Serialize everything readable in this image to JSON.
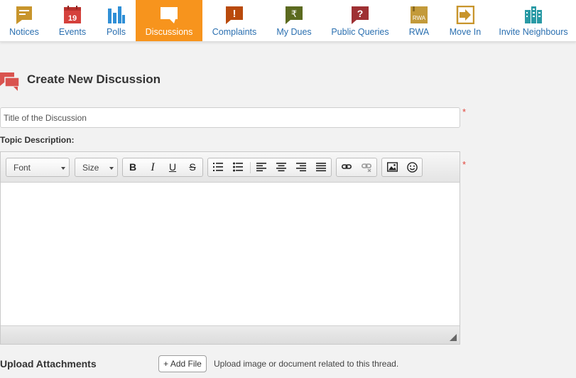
{
  "nav": {
    "items": [
      {
        "label": "Notices",
        "icon": "notice-icon",
        "color": "#c8952c"
      },
      {
        "label": "Events",
        "icon": "calendar-icon",
        "color": "#d5413c",
        "icon_text": "19"
      },
      {
        "label": "Polls",
        "icon": "bar-chart-icon",
        "color": "#2f8fd6"
      },
      {
        "label": "Discussions",
        "icon": "speech-bubble-icon",
        "color": "#ffffff",
        "active": true
      },
      {
        "label": "Complaints",
        "icon": "complaint-icon",
        "color": "#b94a0c",
        "icon_text": "!"
      },
      {
        "label": "My Dues",
        "icon": "rupee-icon",
        "color": "#5b6a1f",
        "icon_text": "₹"
      },
      {
        "label": "Public Queries",
        "icon": "question-icon",
        "color": "#9e3033",
        "icon_text": "?"
      },
      {
        "label": "RWA",
        "icon": "rwa-icon",
        "color": "#c39a3a",
        "icon_text": "RWA"
      },
      {
        "label": "Move In",
        "icon": "move-in-icon",
        "color": "#c8952c"
      },
      {
        "label": "Invite Neighbours",
        "icon": "buildings-icon",
        "color": "#2a9aa5"
      }
    ],
    "active_color": "#f7941d"
  },
  "form": {
    "title": "Create New Discussion",
    "title_placeholder": "Title of the Discussion",
    "topic_label": "Topic Description:",
    "required_marker": "*",
    "editor": {
      "font_label": "Font",
      "size_label": "Size",
      "bold_label": "B",
      "italic_label": "I",
      "underline_label": "U",
      "strike_label": "S"
    },
    "upload_label": "Upload Attachments",
    "add_file_label": "+ Add File",
    "upload_hint": "Upload image or document related to this thread."
  },
  "colors": {
    "accent": "#f7941d",
    "link": "#2a6fb0",
    "required": "#e2453c",
    "heading_icon": "#d9534f"
  }
}
